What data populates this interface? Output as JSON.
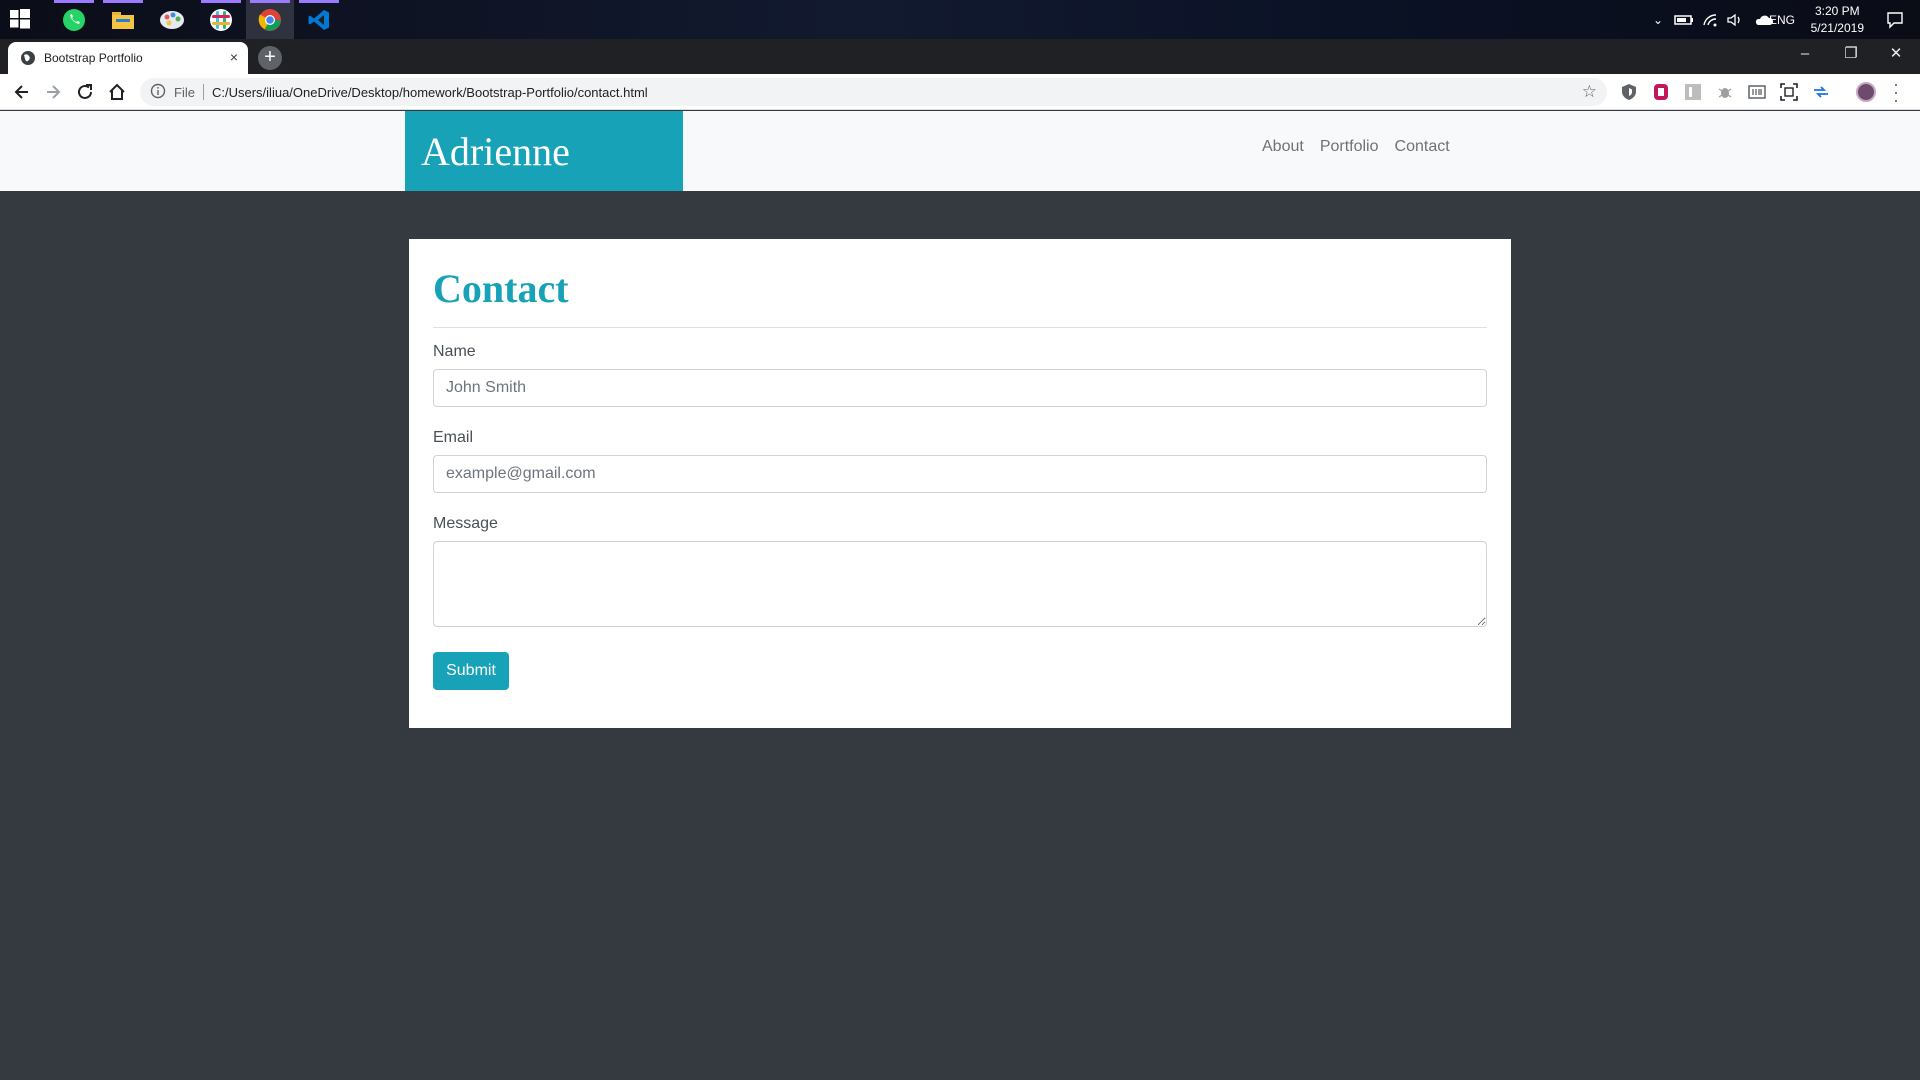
{
  "taskbar": {
    "apps": [
      {
        "name": "whatsapp-icon",
        "color": "#25d366"
      },
      {
        "name": "file-explorer-icon",
        "color": "#f4c542"
      },
      {
        "name": "paint-icon",
        "color": "#e05a5a"
      },
      {
        "name": "slack-icon",
        "color": "#e01e5a"
      },
      {
        "name": "chrome-icon",
        "color": "#4285f4"
      },
      {
        "name": "vscode-icon",
        "color": "#0078d4"
      }
    ],
    "language": "ENG",
    "time": "3:20 PM",
    "date": "5/21/2019"
  },
  "browser": {
    "tab_title": "Bootstrap Portfolio",
    "tab_close": "×",
    "new_tab": "+",
    "window_controls": {
      "minimize": "–",
      "restore": "❐",
      "close": "✕"
    },
    "omnibox": {
      "scheme_label": "File",
      "url": "C:/Users/iliua/OneDrive/Desktop/homework/Bootstrap-Portfolio/contact.html"
    }
  },
  "site": {
    "brand": "Adrienne",
    "nav": [
      "About",
      "Portfolio",
      "Contact"
    ],
    "accent_color": "#17a2b8"
  },
  "contact": {
    "title": "Contact",
    "name_label": "Name",
    "name_placeholder": "John Smith",
    "email_label": "Email",
    "email_placeholder": "example@gmail.com",
    "message_label": "Message",
    "message_placeholder": "",
    "submit_label": "Submit"
  }
}
